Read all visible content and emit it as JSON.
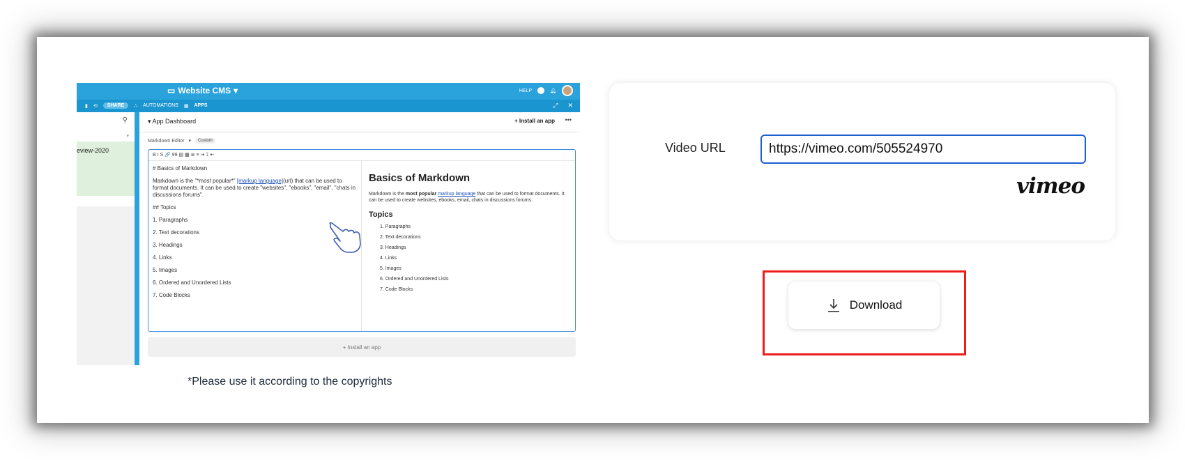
{
  "screenshot": {
    "app_title": "Website CMS",
    "help_label": "HELP",
    "share_label": "SHARE",
    "automations_label": "AUTOMATIONS",
    "apps_label": "APPS",
    "sidebar_row_label": "eview-2020",
    "dashboard_title": "App Dashboard",
    "install_app_top": "Install an app",
    "editor_label": "Markdown Editor",
    "editor_mode": "Custom",
    "toolbar_glyphs": "B  I  S  🔗  99  ▤  ▦  ≣  ≡  ⇥  ⌶  ⇤",
    "source_heading": "# Basics of Markdown",
    "source_para_1": "Markdown is the \"*most popular*\" ",
    "source_link": "[markup language]",
    "source_para_2": "(url) that can be used to format documents. It can be used to create \"websites\", \"ebooks\", \"email\", \"chats in discussions forums\".",
    "source_topics": "## Topics",
    "source_items": [
      "1. Paragraphs",
      "2.  Text decorations",
      "3. Headings",
      "4. Links",
      "5. Images",
      "6. Ordered and Unordered Lists",
      "7. Code Blocks"
    ],
    "preview_heading": "Basics of Markdown",
    "preview_para_1": "Markdown is the ",
    "preview_bold": "most popular",
    "preview_link": "markup language",
    "preview_para_2": " that can be used to format documents. It can be used to create websites, ebooks, email, chats in discussions forums.",
    "preview_topics": "Topics",
    "preview_items": [
      "1. Paragraphs",
      "2. Text decorations",
      "3. Headings",
      "4. Links",
      "5. Images",
      "6. Ordered and Unordered Lists",
      "7. Code Blocks"
    ],
    "install_app_bottom": "+ Install an app"
  },
  "caption": "*Please use it according to the copyrights",
  "form": {
    "label": "Video URL",
    "url_value": "https://vimeo.com/505524970",
    "logo_text": "vimeo"
  },
  "download": {
    "label": "Download",
    "icon": "download-icon"
  },
  "colors": {
    "accent_blue": "#1b5fd1",
    "highlight_red": "#ef1c1c",
    "airtable_blue": "#2aa3dc"
  }
}
